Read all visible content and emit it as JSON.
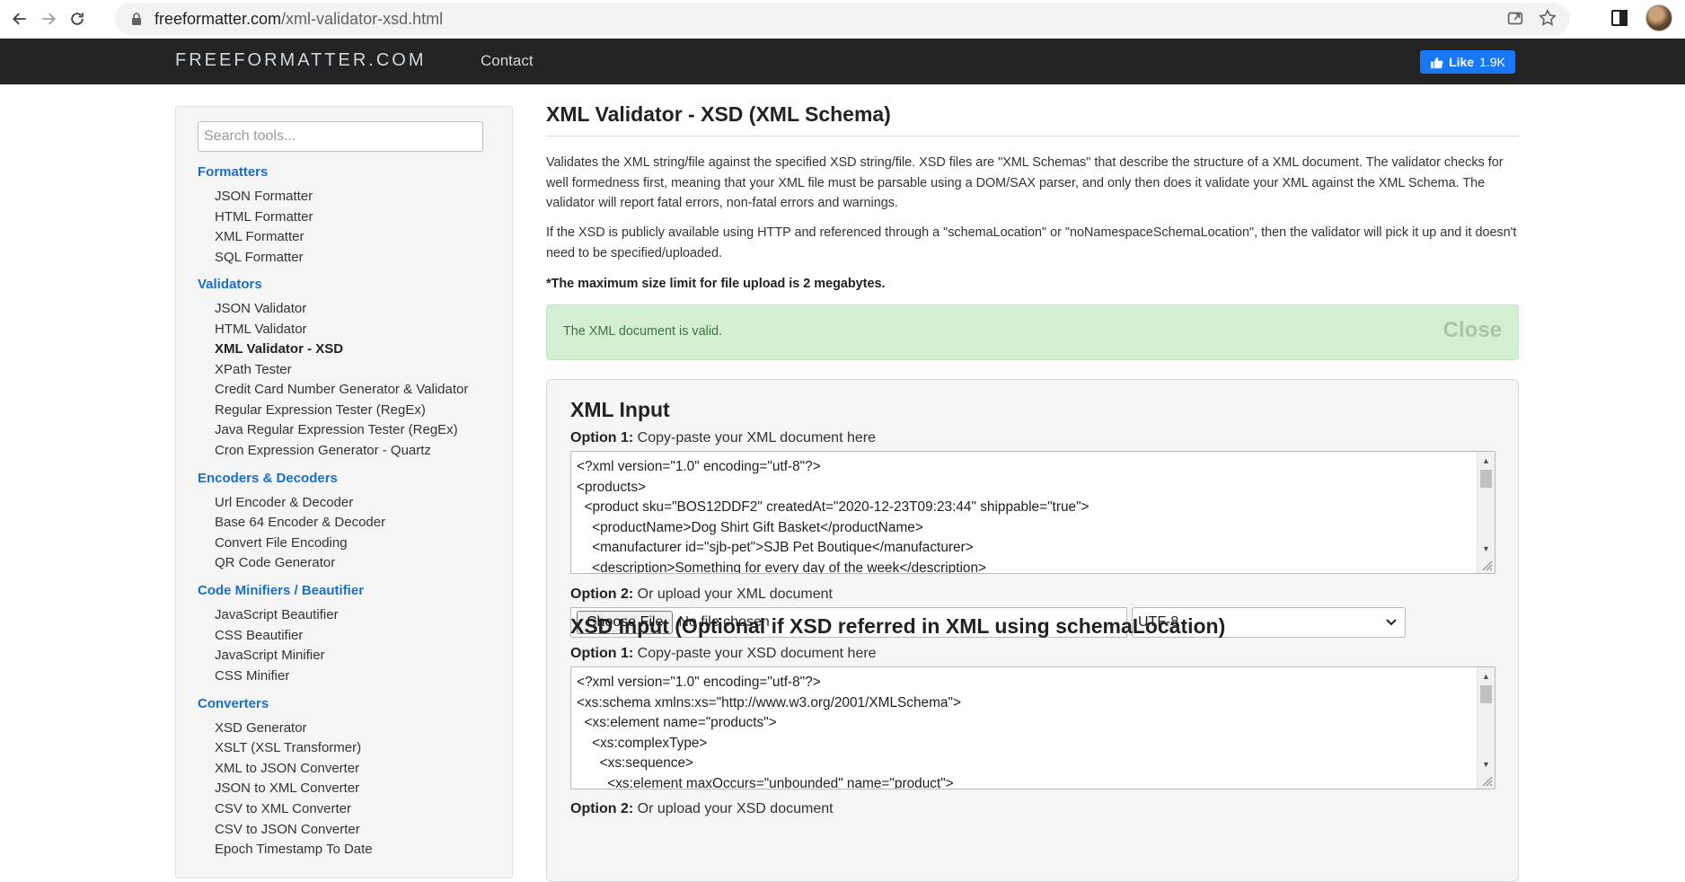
{
  "browser": {
    "url_host": "freeformatter.com",
    "url_path": "/xml-validator-xsd.html"
  },
  "site": {
    "brand": "FREEFORMATTER.COM",
    "nav_contact": "Contact",
    "like_label": "Like",
    "like_count": "1.9K"
  },
  "sidebar": {
    "search_placeholder": "Search tools...",
    "categories": [
      {
        "title": "Formatters",
        "items": [
          "JSON Formatter",
          "HTML Formatter",
          "XML Formatter",
          "SQL Formatter"
        ]
      },
      {
        "title": "Validators",
        "items": [
          "JSON Validator",
          "HTML Validator",
          "XML Validator - XSD",
          "XPath Tester",
          "Credit Card Number Generator & Validator",
          "Regular Expression Tester (RegEx)",
          "Java Regular Expression Tester (RegEx)",
          "Cron Expression Generator - Quartz"
        ]
      },
      {
        "title": "Encoders & Decoders",
        "items": [
          "Url Encoder & Decoder",
          "Base 64 Encoder & Decoder",
          "Convert File Encoding",
          "QR Code Generator"
        ]
      },
      {
        "title": "Code Minifiers / Beautifier",
        "items": [
          "JavaScript Beautifier",
          "CSS Beautifier",
          "JavaScript Minifier",
          "CSS Minifier"
        ]
      },
      {
        "title": "Converters",
        "items": [
          "XSD Generator",
          "XSLT (XSL Transformer)",
          "XML to JSON Converter",
          "JSON to XML Converter",
          "CSV to XML Converter",
          "CSV to JSON Converter",
          "Epoch Timestamp To Date"
        ]
      }
    ]
  },
  "main": {
    "title": "XML Validator - XSD (XML Schema)",
    "para1": "Validates the XML string/file against the specified XSD string/file. XSD files are \"XML Schemas\" that describe the structure of a XML document. The validator checks for well formedness first, meaning that your XML file must be parsable using a DOM/SAX parser, and only then does it validate your XML against the XML Schema. The validator will report fatal errors, non-fatal errors and warnings.",
    "para2": "If the XSD is publicly available using HTTP and referenced through a \"schemaLocation\" or \"noNamespaceSchemaLocation\", then the validator will pick it up and it doesn't need to be specified/uploaded.",
    "limit": "*The maximum size limit for file upload is 2 megabytes.",
    "alert_message": "The XML document is valid.",
    "alert_close": "Close",
    "xml_section_title": "XML Input",
    "xml_opt1_bold": "Option 1:",
    "xml_opt1_text": " Copy-paste your XML document here",
    "xml_code": "<?xml version=\"1.0\" encoding=\"utf-8\"?>\n<products>\n  <product sku=\"BOS12DDF2\" createdAt=\"2020-12-23T09:23:44\" shippable=\"true\">\n    <productName>Dog Shirt Gift Basket</productName>\n    <manufacturer id=\"sjb-pet\">SJB Pet Boutique</manufacturer>\n    <description>Something for every day of the week</description>",
    "xml_opt2_bold": "Option 2:",
    "xml_opt2_text": " Or upload your XML document",
    "choose_file": "Choose File",
    "no_file": "No file chosen",
    "encoding": "UTF-8",
    "xsd_section_title": "XSD Input (Optional if XSD referred in XML using schemaLocation)",
    "xsd_opt1_bold": "Option 1:",
    "xsd_opt1_text": " Copy-paste your XSD document here",
    "xsd_code": "<?xml version=\"1.0\" encoding=\"utf-8\"?>\n<xs:schema xmlns:xs=\"http://www.w3.org/2001/XMLSchema\">\n  <xs:element name=\"products\">\n    <xs:complexType>\n      <xs:sequence>\n        <xs:element maxOccurs=\"unbounded\" name=\"product\">",
    "xsd_opt2_bold": "Option 2:",
    "xsd_opt2_text": " Or upload your XSD document"
  }
}
